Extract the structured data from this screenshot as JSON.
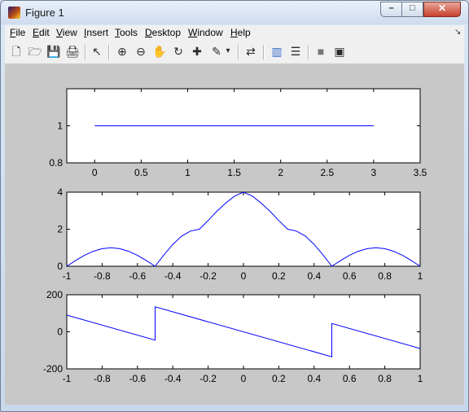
{
  "window": {
    "title": "Figure 1",
    "controls": {
      "minimize": "–",
      "maximize": "□",
      "close": "✕"
    }
  },
  "menu": {
    "items": [
      {
        "mnemonic": "F",
        "rest": "ile"
      },
      {
        "mnemonic": "E",
        "rest": "dit"
      },
      {
        "mnemonic": "V",
        "rest": "iew"
      },
      {
        "mnemonic": "I",
        "rest": "nsert"
      },
      {
        "mnemonic": "T",
        "rest": "ools"
      },
      {
        "mnemonic": "D",
        "rest": "esktop"
      },
      {
        "mnemonic": "W",
        "rest": "indow"
      },
      {
        "mnemonic": "H",
        "rest": "elp"
      }
    ],
    "dock_glyph": "↘"
  },
  "toolbar": {
    "glyphs": {
      "new": "🗋",
      "open": "🗁",
      "save": "💾",
      "print": "🖨",
      "select": "↖",
      "zoom_in": "⊕",
      "zoom_out": "⊖",
      "pan": "✋",
      "rotate": "↻",
      "data_cursor": "✚",
      "brush": "✎",
      "brush_menu": "▾",
      "link": "⇄",
      "colorbar": "▥",
      "legend": "☰",
      "hide_tools": "■",
      "show_tools": "▣"
    }
  },
  "chart_data": [
    {
      "type": "line",
      "title": "",
      "xlabel": "",
      "ylabel": "",
      "xlim": [
        -0.3,
        3.5
      ],
      "ylim": [
        0.8,
        1.2
      ],
      "xticks": [
        "0",
        "0.5",
        "1",
        "1.5",
        "2",
        "2.5",
        "3",
        "3.5"
      ],
      "yticks": [
        "0.8",
        "1"
      ],
      "series": [
        {
          "x": [
            0,
            3
          ],
          "y": [
            1,
            1
          ]
        }
      ]
    },
    {
      "type": "line",
      "title": "",
      "xlabel": "",
      "ylabel": "",
      "xlim": [
        -1,
        1
      ],
      "ylim": [
        0,
        4
      ],
      "xticks": [
        "-1",
        "-0.8",
        "-0.6",
        "-0.4",
        "-0.2",
        "0",
        "0.2",
        "0.4",
        "0.6",
        "0.8",
        "1"
      ],
      "yticks": [
        "0",
        "2",
        "4"
      ],
      "series": [
        {
          "x": [
            -1,
            -0.95,
            -0.9,
            -0.85,
            -0.8,
            -0.75,
            -0.7,
            -0.65,
            -0.6,
            -0.55,
            -0.5,
            -0.45,
            -0.4,
            -0.35,
            -0.3,
            -0.25,
            -0.2,
            -0.15,
            -0.1,
            -0.05,
            0,
            0.05,
            0.1,
            0.15,
            0.2,
            0.25,
            0.3,
            0.35,
            0.4,
            0.45,
            0.5,
            0.55,
            0.6,
            0.65,
            0.7,
            0.75,
            0.8,
            0.85,
            0.9,
            0.95,
            1
          ],
          "y": [
            0,
            0.31,
            0.59,
            0.81,
            0.95,
            1.0,
            0.95,
            0.81,
            0.59,
            0.31,
            0,
            0.62,
            1.18,
            1.63,
            1.9,
            2.0,
            2.47,
            2.97,
            3.41,
            3.79,
            4.0,
            3.79,
            3.41,
            2.97,
            2.47,
            2.0,
            1.9,
            1.63,
            1.18,
            0.62,
            0,
            0.31,
            0.59,
            0.81,
            0.95,
            1.0,
            0.95,
            0.81,
            0.59,
            0.31,
            0
          ]
        }
      ]
    },
    {
      "type": "line",
      "title": "",
      "xlabel": "",
      "ylabel": "",
      "xlim": [
        -1,
        1
      ],
      "ylim": [
        -200,
        200
      ],
      "xticks": [
        "-1",
        "-0.8",
        "-0.6",
        "-0.4",
        "-0.2",
        "0",
        "0.2",
        "0.4",
        "0.6",
        "0.8",
        "1"
      ],
      "yticks": [
        "-200",
        "0",
        "200"
      ],
      "series": [
        {
          "x": [
            -1,
            -0.5,
            -0.5,
            0.5,
            0.5,
            1
          ],
          "y": [
            90,
            -45,
            135,
            -135,
            45,
            -90
          ]
        }
      ]
    }
  ]
}
